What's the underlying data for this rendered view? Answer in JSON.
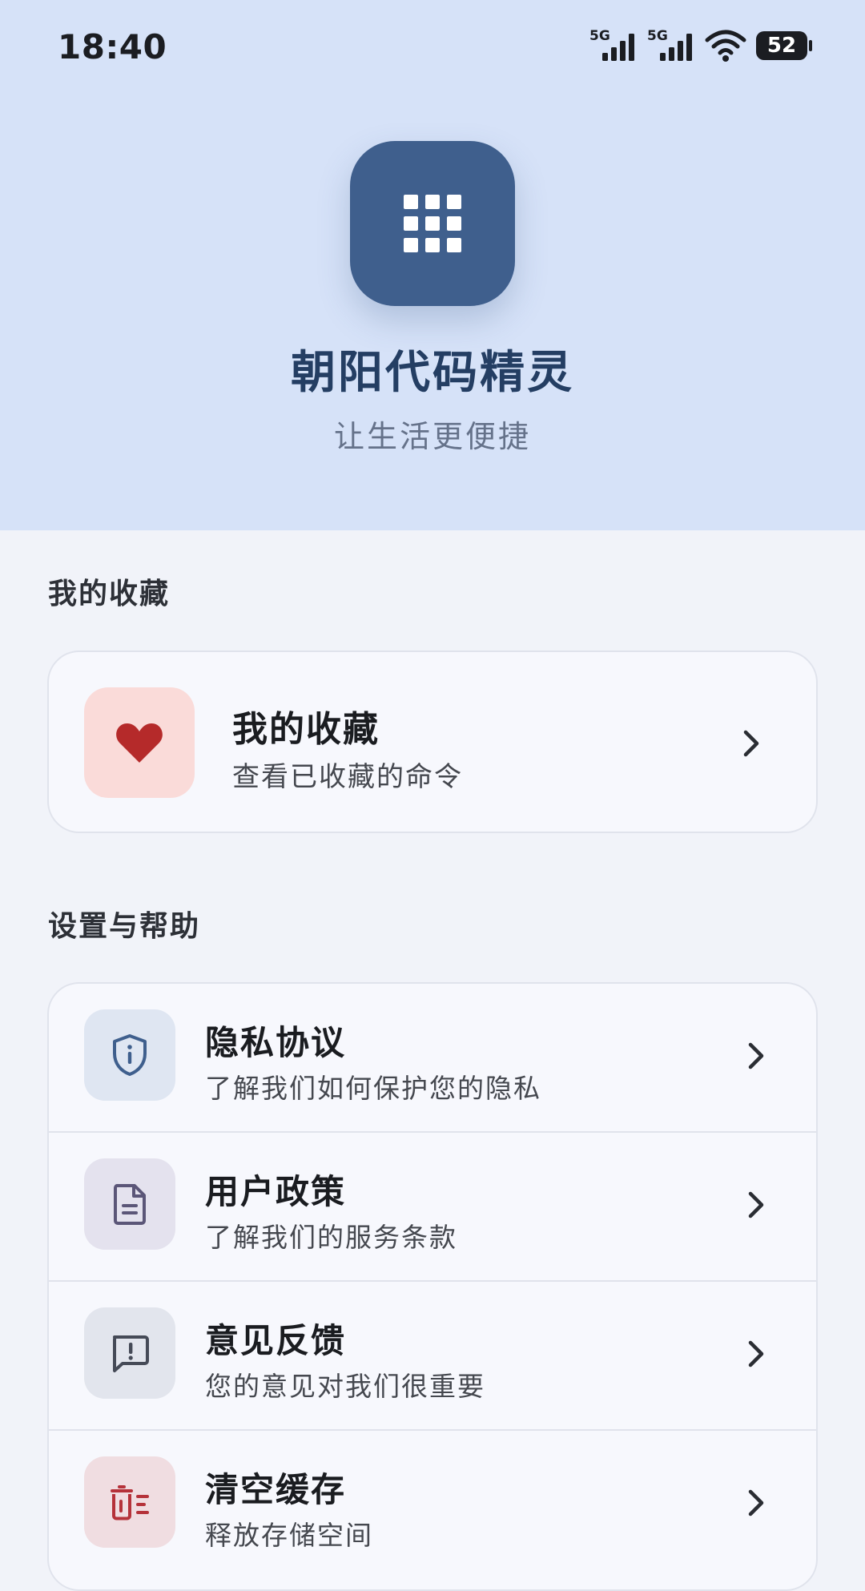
{
  "status_bar": {
    "time": "18:40",
    "signal_label_1": "5G",
    "signal_label_2": "5G",
    "battery": "52"
  },
  "app": {
    "name": "朝阳代码精灵",
    "slogan": "让生活更便捷",
    "logo_icon": "grid-icon"
  },
  "favorites_section": {
    "title": "我的收藏",
    "card": {
      "icon": "heart-icon",
      "title": "我的收藏",
      "subtitle": "查看已收藏的命令"
    }
  },
  "settings_section": {
    "title": "设置与帮助",
    "items": [
      {
        "icon": "shield-info-icon",
        "title": "隐私协议",
        "subtitle": "了解我们如何保护您的隐私"
      },
      {
        "icon": "document-icon",
        "title": "用户政策",
        "subtitle": "了解我们的服务条款"
      },
      {
        "icon": "feedback-icon",
        "title": "意见反馈",
        "subtitle": "您的意见对我们很重要"
      },
      {
        "icon": "clear-cache-icon",
        "title": "清空缓存",
        "subtitle": "释放存储空间"
      }
    ]
  },
  "colors": {
    "header_bg": "#d6e2f8",
    "page_bg": "#f1f3f9",
    "brand": "#3f5f8d",
    "title_blue": "#243e63",
    "heart_red": "#b52a2a",
    "danger_red": "#b5323a"
  }
}
